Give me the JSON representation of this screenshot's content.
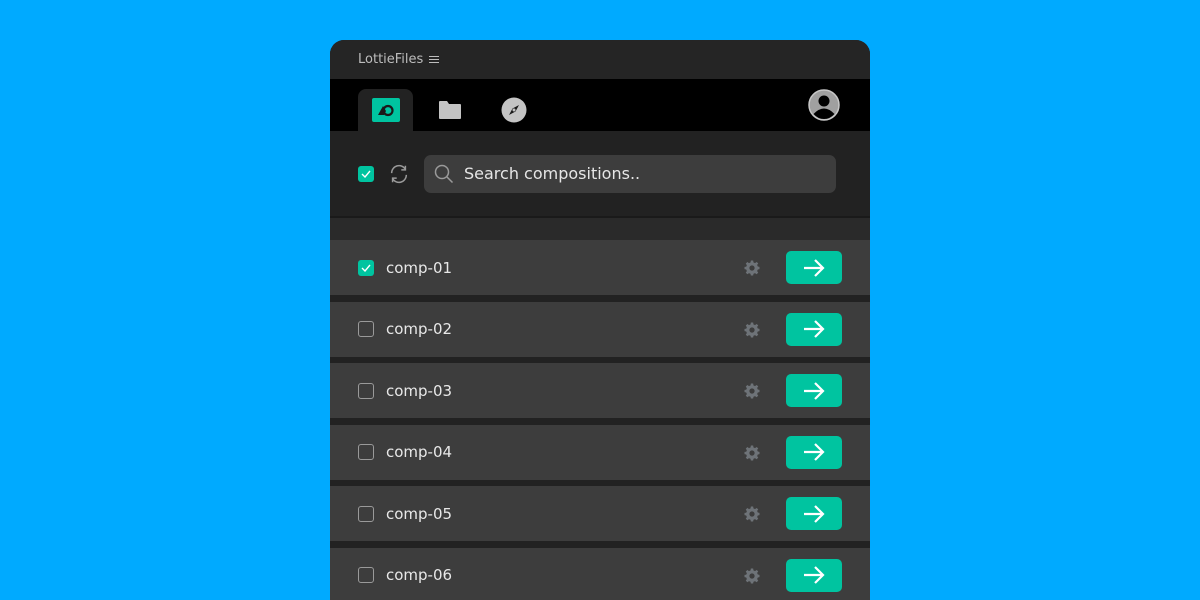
{
  "app": {
    "title": "LottieFiles",
    "menu_icon": "hamburger-icon"
  },
  "tabs": [
    {
      "name": "compositions",
      "icon": "shapes-icon",
      "active": true
    },
    {
      "name": "files",
      "icon": "folder-icon",
      "active": false
    },
    {
      "name": "discover",
      "icon": "compass-icon",
      "active": false
    }
  ],
  "user": {
    "icon": "user-avatar-icon"
  },
  "toolbar": {
    "select_all_checked": true,
    "refresh_icon": "refresh-icon",
    "search": {
      "placeholder": "Search compositions..",
      "value": "",
      "icon": "search-icon"
    }
  },
  "compositions": [
    {
      "name": "comp-01",
      "checked": true
    },
    {
      "name": "comp-02",
      "checked": false
    },
    {
      "name": "comp-03",
      "checked": false
    },
    {
      "name": "comp-04",
      "checked": false
    },
    {
      "name": "comp-05",
      "checked": false
    },
    {
      "name": "comp-06",
      "checked": false
    }
  ],
  "colors": {
    "accent": "#00c4a0",
    "background": "#00aaff",
    "panel": "#222222",
    "row": "#3d3d3d"
  }
}
